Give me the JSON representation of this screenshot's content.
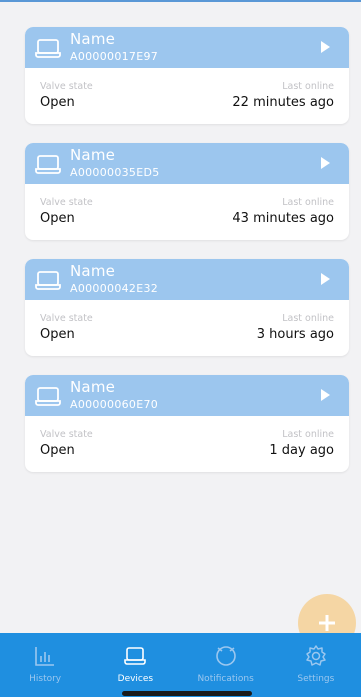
{
  "devices": [
    {
      "name": "Name",
      "id": "A00000017E97",
      "valve_state_label": "Valve state",
      "valve_state": "Open",
      "last_online_label": "Last online",
      "last_online": "22 minutes ago"
    },
    {
      "name": "Name",
      "id": "A00000035ED5",
      "valve_state_label": "Valve state",
      "valve_state": "Open",
      "last_online_label": "Last online",
      "last_online": "43 minutes ago"
    },
    {
      "name": "Name",
      "id": "A00000042E32",
      "valve_state_label": "Valve state",
      "valve_state": "Open",
      "last_online_label": "Last online",
      "last_online": "3 hours ago"
    },
    {
      "name": "Name",
      "id": "A00000060E70",
      "valve_state_label": "Valve state",
      "valve_state": "Open",
      "last_online_label": "Last online",
      "last_online": "1 day ago"
    }
  ],
  "tabs": [
    {
      "label": "History",
      "icon": "chart-icon",
      "active": false
    },
    {
      "label": "Devices",
      "icon": "device-icon",
      "active": true
    },
    {
      "label": "Notifications",
      "icon": "bell-icon",
      "active": false
    },
    {
      "label": "Settings",
      "icon": "gear-icon",
      "active": false
    }
  ],
  "fab": {
    "icon": "plus-icon"
  },
  "colors": {
    "accent": "#1f8fe0",
    "card_header": "#9cc6ee",
    "fab": "#f5d6a4"
  }
}
